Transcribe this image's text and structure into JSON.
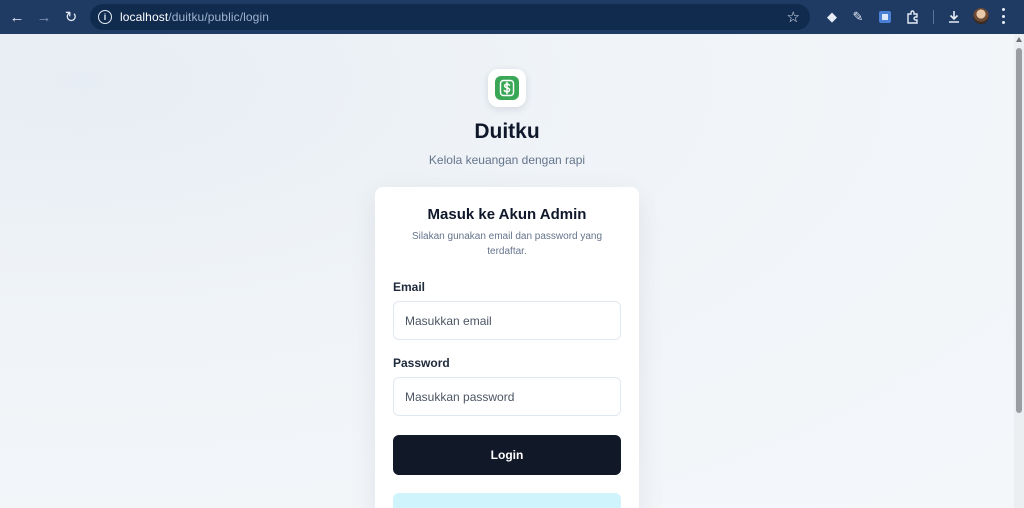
{
  "browser": {
    "url_host": "localhost",
    "url_path": "/duitku/public/login",
    "colors": {
      "toolbar": "#1f3a63",
      "omnibox": "#112b4f"
    }
  },
  "brand": {
    "name": "Duitku",
    "tagline": "Kelola keuangan dengan rapi",
    "logo_icon": "dollar-sign-icon",
    "logo_color": "#3aa757"
  },
  "login_card": {
    "title": "Masuk ke Akun Admin",
    "subtitle": "Silakan gunakan email dan password yang terdaftar.",
    "email_label": "Email",
    "email_placeholder": "Masukkan email",
    "email_value": "",
    "password_label": "Password",
    "password_placeholder": "Masukkan password",
    "password_value": "",
    "submit_label": "Login",
    "button_color": "#111827",
    "info_color": "#cff4fc"
  }
}
